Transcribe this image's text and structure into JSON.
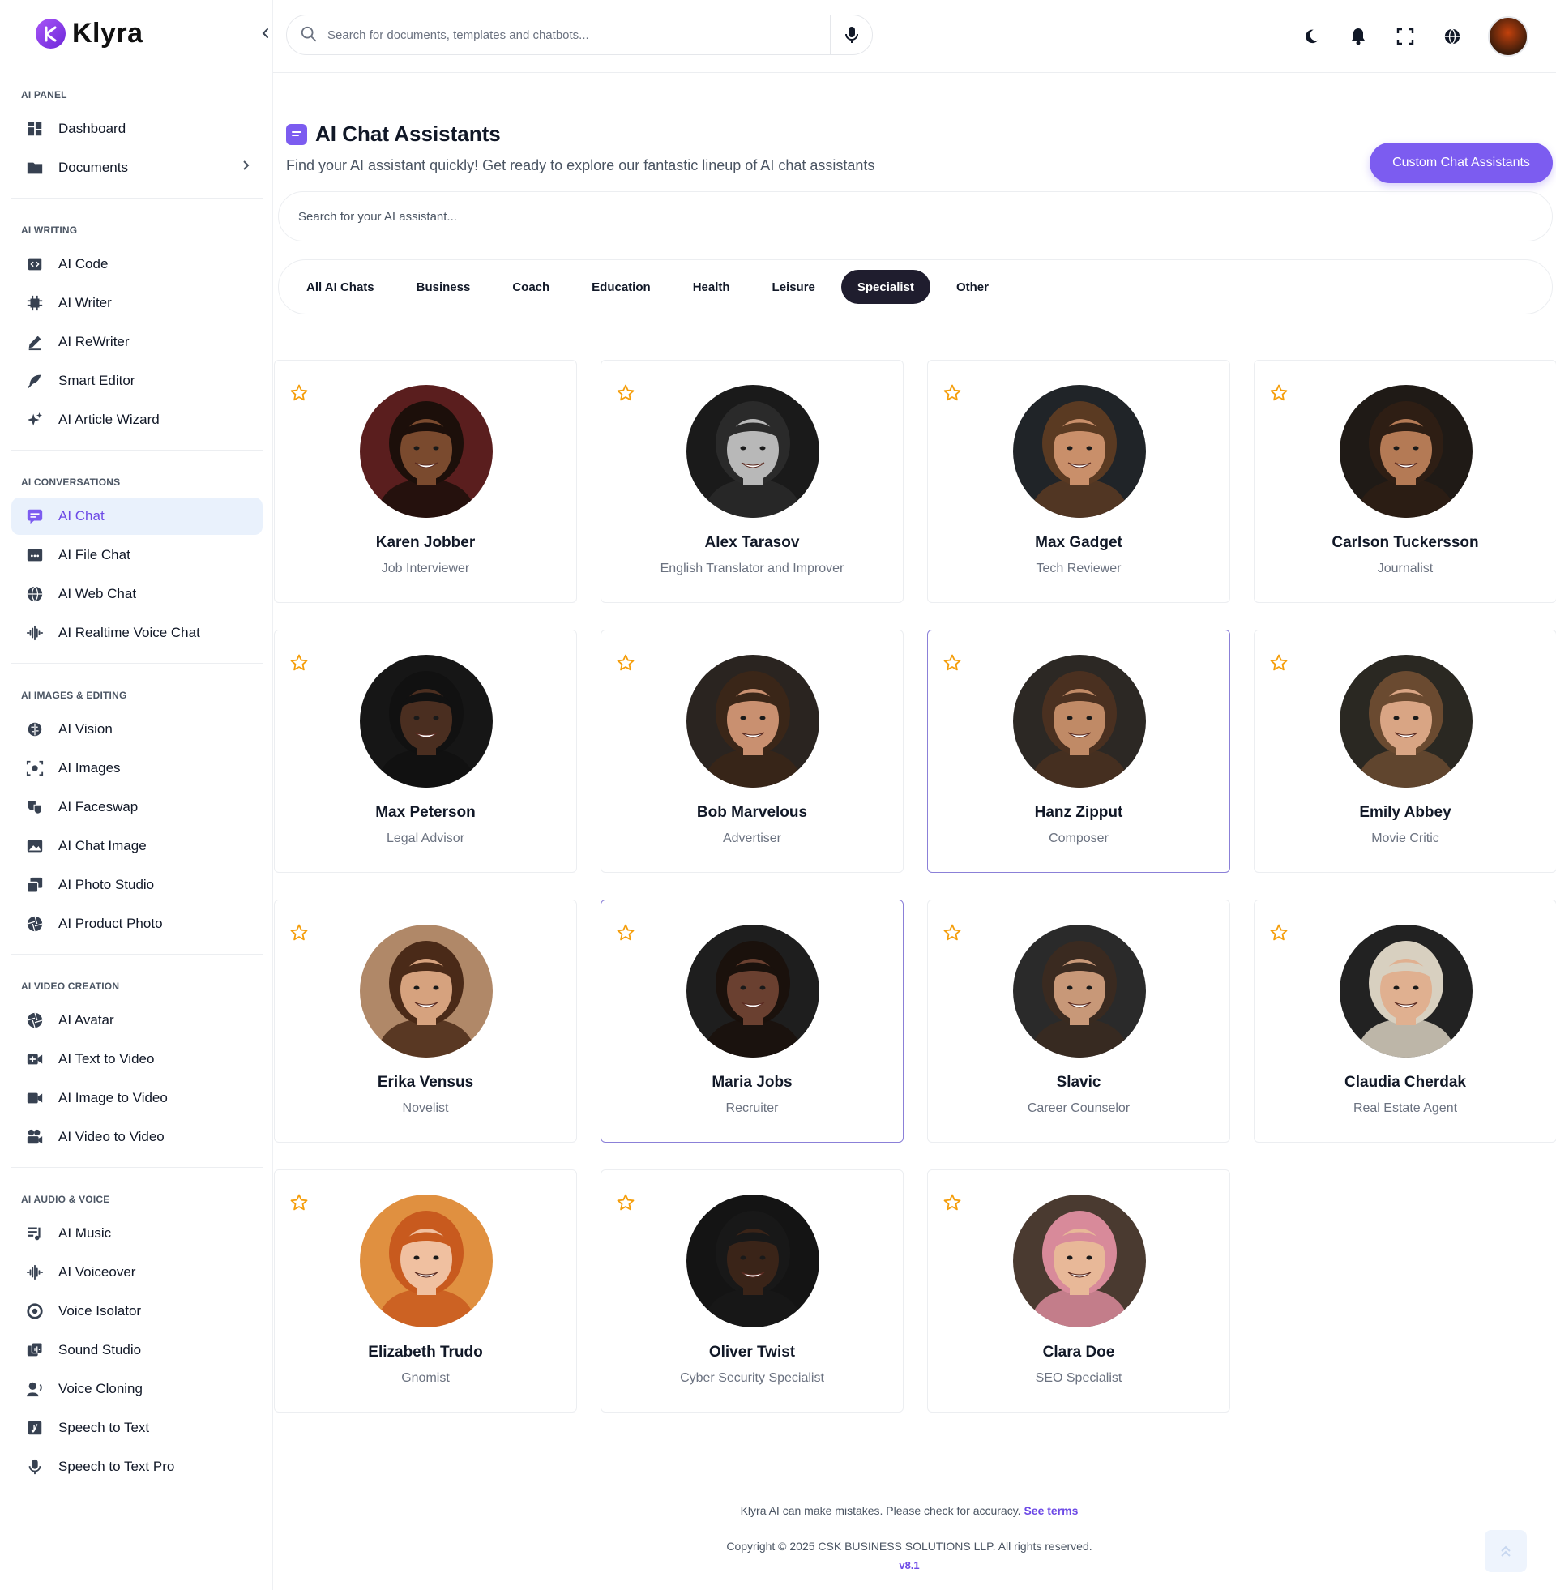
{
  "app": {
    "name": "Klyra"
  },
  "topbar": {
    "search_placeholder": "Search for documents, templates and chatbots..."
  },
  "sidebar": {
    "sections": [
      {
        "title": "AI PANEL",
        "items": [
          {
            "label": "Dashboard",
            "icon": "dashboard-icon"
          },
          {
            "label": "Documents",
            "icon": "folder-icon",
            "has_chevron": true
          }
        ]
      },
      {
        "title": "AI WRITING",
        "items": [
          {
            "label": "AI Code",
            "icon": "code-icon"
          },
          {
            "label": "AI Writer",
            "icon": "chip-icon"
          },
          {
            "label": "AI ReWriter",
            "icon": "pen-icon"
          },
          {
            "label": "Smart Editor",
            "icon": "feather-icon"
          },
          {
            "label": "AI Article Wizard",
            "icon": "sparkles-icon"
          }
        ]
      },
      {
        "title": "AI CONVERSATIONS",
        "items": [
          {
            "label": "AI Chat",
            "icon": "chat-icon",
            "active": true
          },
          {
            "label": "AI File Chat",
            "icon": "file-chat-icon"
          },
          {
            "label": "AI Web Chat",
            "icon": "globe-icon"
          },
          {
            "label": "AI Realtime Voice Chat",
            "icon": "waveform-icon"
          }
        ]
      },
      {
        "title": "AI IMAGES & EDITING",
        "items": [
          {
            "label": "AI Vision",
            "icon": "brain-icon"
          },
          {
            "label": "AI Images",
            "icon": "camera-scan-icon"
          },
          {
            "label": "AI Faceswap",
            "icon": "masks-icon"
          },
          {
            "label": "AI Chat Image",
            "icon": "image-icon"
          },
          {
            "label": "AI Photo Studio",
            "icon": "photos-icon"
          },
          {
            "label": "AI Product Photo",
            "icon": "aperture-icon"
          }
        ]
      },
      {
        "title": "AI VIDEO CREATION",
        "items": [
          {
            "label": "AI Avatar",
            "icon": "aperture-icon"
          },
          {
            "label": "AI Text to Video",
            "icon": "video-plus-icon"
          },
          {
            "label": "AI Image to Video",
            "icon": "video-icon"
          },
          {
            "label": "AI Video to Video",
            "icon": "film-camera-icon"
          }
        ]
      },
      {
        "title": "AI AUDIO & VOICE",
        "items": [
          {
            "label": "AI Music",
            "icon": "music-list-icon"
          },
          {
            "label": "AI Voiceover",
            "icon": "waveform-icon"
          },
          {
            "label": "Voice Isolator",
            "icon": "target-icon"
          },
          {
            "label": "Sound Studio",
            "icon": "sound-studio-icon"
          },
          {
            "label": "Voice Cloning",
            "icon": "user-voice-icon"
          },
          {
            "label": "Speech to Text",
            "icon": "music-file-icon"
          },
          {
            "label": "Speech to Text Pro",
            "icon": "microphone-icon"
          }
        ]
      }
    ]
  },
  "main": {
    "title": "AI Chat Assistants",
    "subtitle": "Find your AI assistant quickly! Get ready to explore our fantastic lineup of AI chat assistants",
    "custom_button": "Custom Chat Assistants",
    "assistant_search_placeholder": "Search for your AI assistant...",
    "tabs": [
      {
        "label": "All AI Chats"
      },
      {
        "label": "Business"
      },
      {
        "label": "Coach"
      },
      {
        "label": "Education"
      },
      {
        "label": "Health"
      },
      {
        "label": "Leisure"
      },
      {
        "label": "Specialist",
        "active": true
      },
      {
        "label": "Other"
      }
    ],
    "assistants": [
      {
        "name": "Karen Jobber",
        "role": "Job Interviewer",
        "skin": "#7a4a2e",
        "hair": "#1c0f0a",
        "bg": "#5a1e1e"
      },
      {
        "name": "Alex Tarasov",
        "role": "English Translator and Improver",
        "skin": "#b8b8b8",
        "hair": "#2a2a2a",
        "bg": "#1a1a1a"
      },
      {
        "name": "Max Gadget",
        "role": "Tech Reviewer",
        "skin": "#c98f6a",
        "hair": "#5a3a22",
        "bg": "#202428"
      },
      {
        "name": "Carlson Tuckersson",
        "role": "Journalist",
        "skin": "#b47a55",
        "hair": "#2e1e14",
        "bg": "#1f1a16"
      },
      {
        "name": "Max Peterson",
        "role": "Legal Advisor",
        "skin": "#4a2e20",
        "hair": "#111111",
        "bg": "#161616"
      },
      {
        "name": "Bob Marvelous",
        "role": "Advertiser",
        "skin": "#c99070",
        "hair": "#3a2618",
        "bg": "#2a2420"
      },
      {
        "name": "Hanz Zipput",
        "role": "Composer",
        "skin": "#c08a66",
        "hair": "#4a3020",
        "bg": "#2c2824"
      },
      {
        "name": "Emily Abbey",
        "role": "Movie Critic",
        "skin": "#d9a584",
        "hair": "#6a4a30",
        "bg": "#2a2822"
      },
      {
        "name": "Erika Vensus",
        "role": "Novelist",
        "skin": "#d6a27e",
        "hair": "#4a2a18",
        "bg": "#b08868"
      },
      {
        "name": "Maria Jobs",
        "role": "Recruiter",
        "skin": "#6a4030",
        "hair": "#1a110c",
        "bg": "#1e1e1e"
      },
      {
        "name": "Slavic",
        "role": "Career Counselor",
        "skin": "#c89878",
        "hair": "#3a2a20",
        "bg": "#2a2a2a"
      },
      {
        "name": "Claudia Cherdak",
        "role": "Real Estate Agent",
        "skin": "#e0b090",
        "hair": "#d8d0c0",
        "bg": "#222222"
      },
      {
        "name": "Elizabeth Trudo",
        "role": "Gnomist",
        "skin": "#f0c0a0",
        "hair": "#c85a1e",
        "bg": "#e09040"
      },
      {
        "name": "Oliver Twist",
        "role": "Cyber Security Specialist",
        "skin": "#3a2418",
        "hair": "#181818",
        "bg": "#141414"
      },
      {
        "name": "Clara Doe",
        "role": "SEO Specialist",
        "skin": "#e8b898",
        "hair": "#d88a9a",
        "bg": "#4a3a30"
      }
    ]
  },
  "footer": {
    "disclaimer": "Klyra AI can make mistakes. Please check for accuracy.",
    "terms_link": "See terms",
    "copyright": "Copyright © 2025 CSK BUSINESS SOLUTIONS LLP. All rights reserved.",
    "version": "v8.1"
  },
  "colors": {
    "accent": "#7c5cf0",
    "active_tab": "#1f1d2e",
    "star": "#f59e0b",
    "active_nav_bg": "#e9f1fc"
  }
}
